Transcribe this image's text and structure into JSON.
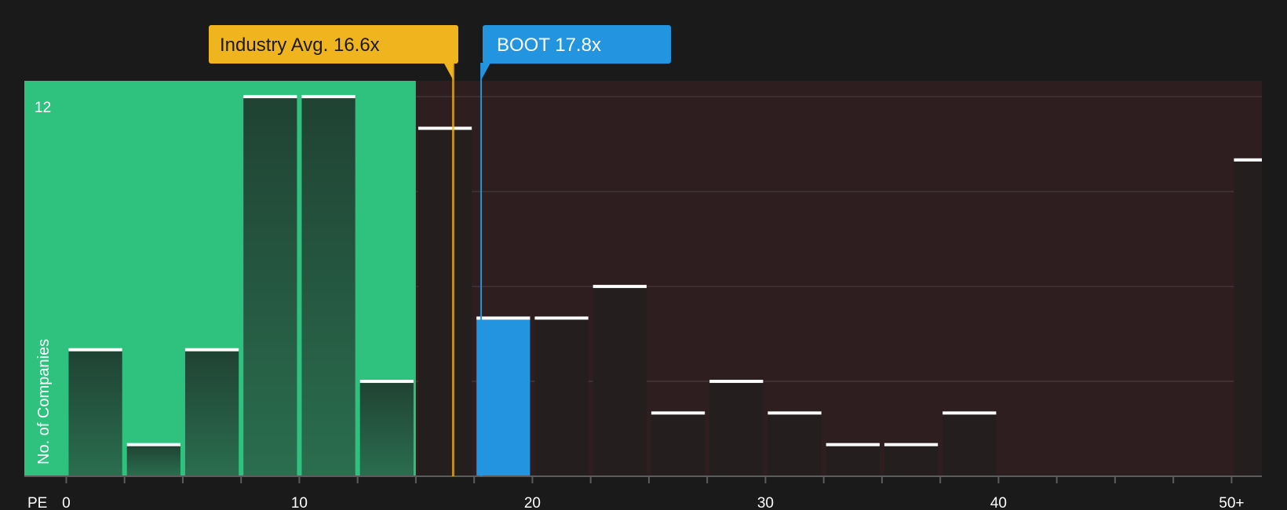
{
  "chart_data": {
    "type": "bar",
    "title": "",
    "xlabel": "PE",
    "ylabel": "No. of Companies",
    "x_ticks": [
      {
        "value": 0,
        "label": "0"
      },
      {
        "value": 10,
        "label": "10"
      },
      {
        "value": 20,
        "label": "20"
      },
      {
        "value": 30,
        "label": "30"
      },
      {
        "value": 40,
        "label": "40"
      },
      {
        "value": 50,
        "label": "50+"
      }
    ],
    "y_ticks": [
      {
        "value": 12,
        "label": "12"
      }
    ],
    "ylim": [
      0,
      12.5
    ],
    "xlim": [
      -1.8,
      51.3
    ],
    "bin_width": 2.5,
    "bins": [
      {
        "start": 0,
        "value": 4
      },
      {
        "start": 2.5,
        "value": 1
      },
      {
        "start": 5,
        "value": 4
      },
      {
        "start": 7.5,
        "value": 12
      },
      {
        "start": 10,
        "value": 12
      },
      {
        "start": 12.5,
        "value": 3
      },
      {
        "start": 15,
        "value": 11
      },
      {
        "start": 17.5,
        "value": 5
      },
      {
        "start": 20,
        "value": 5
      },
      {
        "start": 22.5,
        "value": 6
      },
      {
        "start": 25,
        "value": 2
      },
      {
        "start": 27.5,
        "value": 3
      },
      {
        "start": 30,
        "value": 2
      },
      {
        "start": 32.5,
        "value": 1
      },
      {
        "start": 35,
        "value": 1
      },
      {
        "start": 37.5,
        "value": 2
      },
      {
        "start": 50,
        "value": 10
      }
    ],
    "industry_avg": {
      "value": 16.6,
      "label": "Industry Avg. 16.6x"
    },
    "company": {
      "value": 17.8,
      "label": "BOOT 17.8x",
      "ticker": "BOOT"
    },
    "colors": {
      "background": "#1a1a1a",
      "green_zone": "#2ec27e",
      "red_zone": "#2e1e1f",
      "green_bar_top": "#204233",
      "green_bar_bottom": "#2a6e4e",
      "dark_bar": "#241e1f",
      "company_bar": "#2394e0",
      "industry": "#f0b41f",
      "company": "#2394e0",
      "cap": "#ffffff",
      "grid": "#4a4142",
      "axis": "#5c5c5c"
    },
    "grid": true
  }
}
